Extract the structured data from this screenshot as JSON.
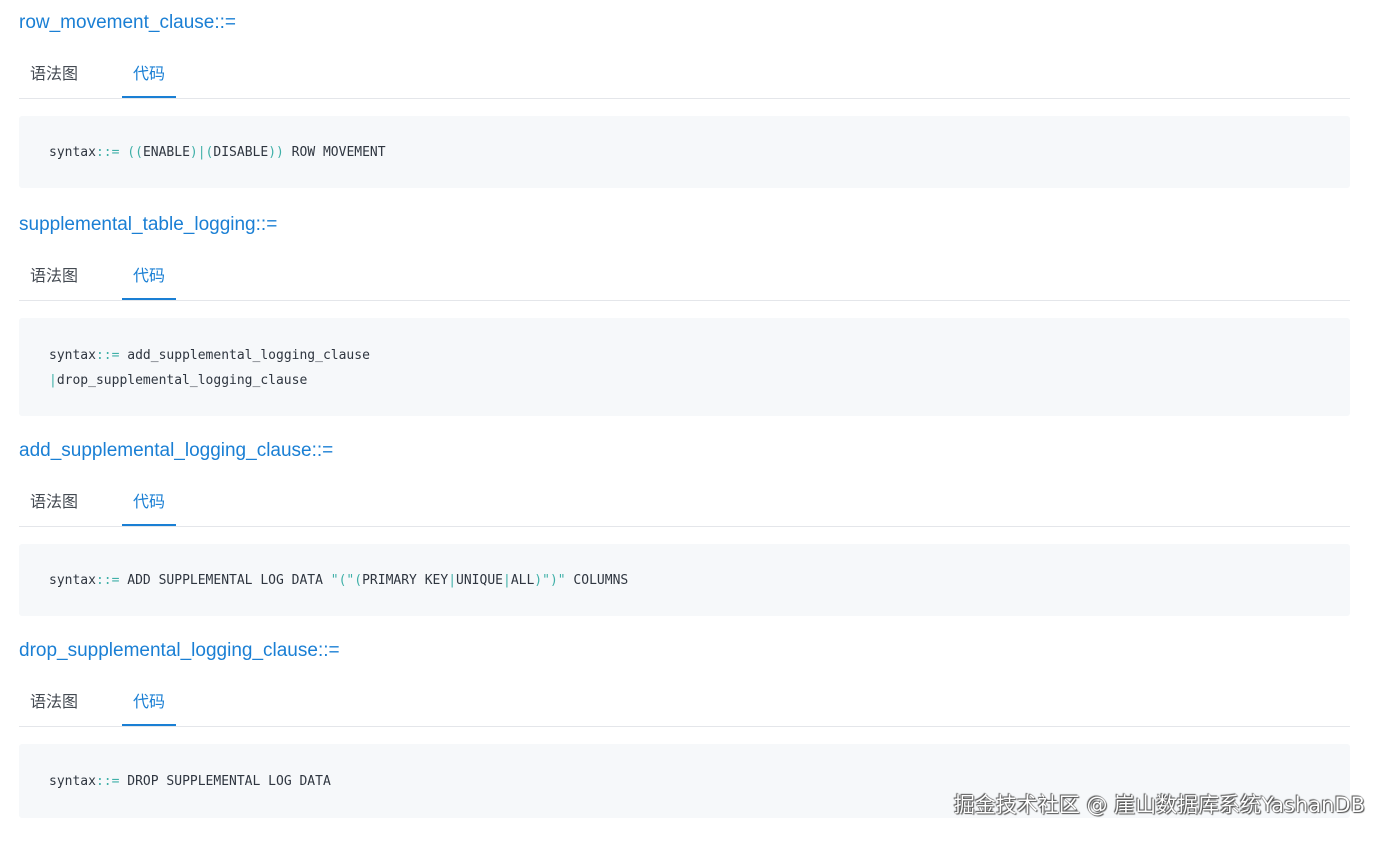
{
  "tabs": {
    "diagram": "语法图",
    "code": "代码"
  },
  "sections": [
    {
      "name": "row_movement_clause",
      "suffix": "::=",
      "lines": [
        [
          [
            "t",
            "syntax"
          ],
          [
            "op",
            "::= (("
          ],
          [
            "t",
            "ENABLE"
          ],
          [
            "op",
            ")|("
          ],
          [
            "t",
            "DISABLE"
          ],
          [
            "op",
            "))"
          ],
          [
            "t",
            " ROW MOVEMENT"
          ]
        ]
      ]
    },
    {
      "name": "supplemental_table_logging",
      "suffix": "::=",
      "lines": [
        [
          [
            "t",
            "syntax"
          ],
          [
            "op",
            "::="
          ],
          [
            "t",
            " add_supplemental_logging_clause"
          ]
        ],
        [
          [
            "op",
            "|"
          ],
          [
            "t",
            "drop_supplemental_logging_clause"
          ]
        ]
      ]
    },
    {
      "name": "add_supplemental_logging_clause",
      "suffix": "::=",
      "lines": [
        [
          [
            "t",
            "syntax"
          ],
          [
            "op",
            "::="
          ],
          [
            "t",
            " ADD SUPPLEMENTAL LOG DATA "
          ],
          [
            "op",
            "\"(\"("
          ],
          [
            "t",
            "PRIMARY KEY"
          ],
          [
            "op",
            "|"
          ],
          [
            "t",
            "UNIQUE"
          ],
          [
            "op",
            "|"
          ],
          [
            "t",
            "ALL"
          ],
          [
            "op",
            ")\")\""
          ],
          [
            "t",
            " COLUMNS"
          ]
        ]
      ]
    },
    {
      "name": "drop_supplemental_logging_clause",
      "suffix": "::=",
      "lines": [
        [
          [
            "t",
            "syntax"
          ],
          [
            "op",
            "::="
          ],
          [
            "t",
            " DROP SUPPLEMENTAL LOG DATA"
          ]
        ]
      ]
    }
  ],
  "watermark": "掘金技术社区 @ 崖山数据库系统YashanDB"
}
